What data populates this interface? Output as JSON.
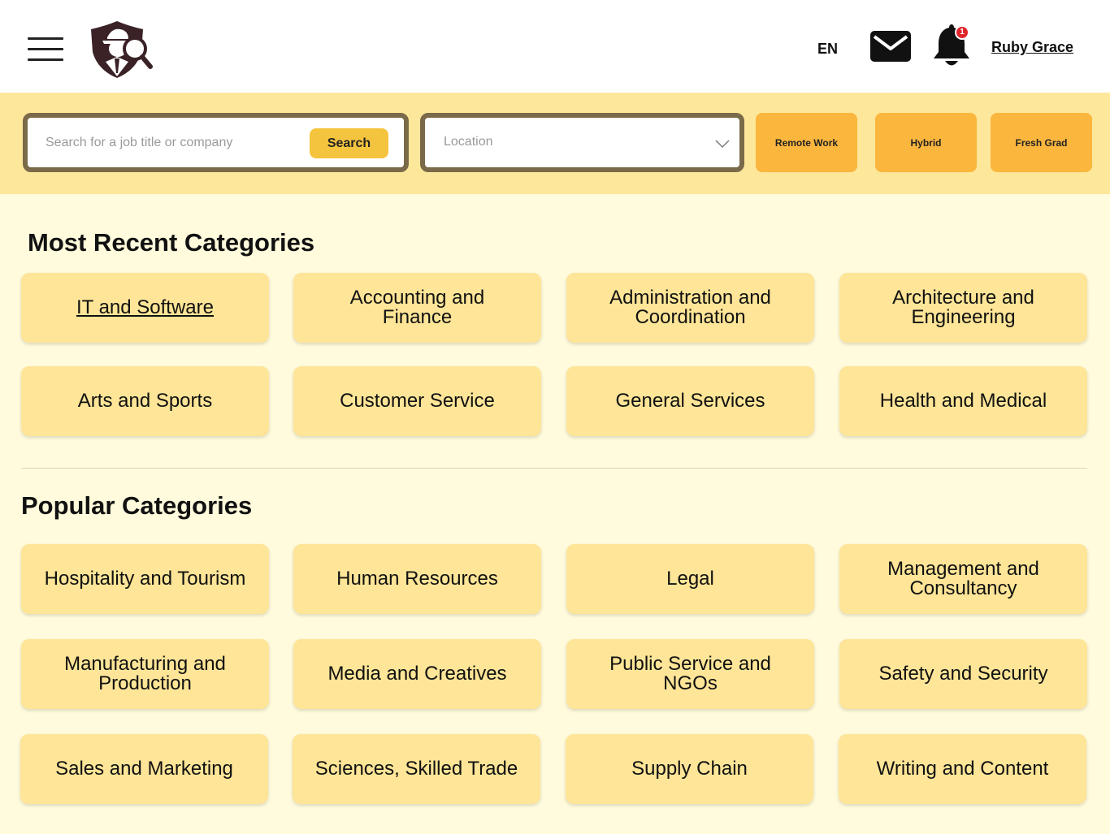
{
  "header": {
    "language": "EN",
    "user_name": "Ruby Grace",
    "notification_count": "1",
    "icons": [
      "menu-icon",
      "detective-logo",
      "mail-icon",
      "bell-icon"
    ]
  },
  "search": {
    "placeholder": "Search for a job title or company",
    "button_label": "Search",
    "location_placeholder": "Location",
    "filters": [
      "Remote Work",
      "Hybrid",
      "Fresh Grad"
    ]
  },
  "most_recent": {
    "title": "Most Recent Categories",
    "items": [
      "IT and Software",
      "Accounting and Finance",
      "Administration and Coordination",
      "Architecture and Engineering",
      "Arts and Sports",
      "Customer Service",
      "General Services",
      "Health and Medical"
    ]
  },
  "popular": {
    "title": "Popular Categories",
    "items": [
      "Hospitality and Tourism",
      "Human Resources",
      "Legal",
      "Management and Consultancy",
      "Manufacturing and Production",
      "Media and Creatives",
      "Public Service and NGOs",
      "Safety and Security",
      "Sales and Marketing",
      "Sciences, Skilled Trade",
      "Supply Chain",
      "Writing and Content"
    ]
  },
  "colors": {
    "search_band": "#fde79a",
    "content_bg": "#fffbdc",
    "card_bg": "#fee597",
    "filter_button": "#fbb63e",
    "search_button": "#f5c43e",
    "badge": "#e0242b"
  }
}
